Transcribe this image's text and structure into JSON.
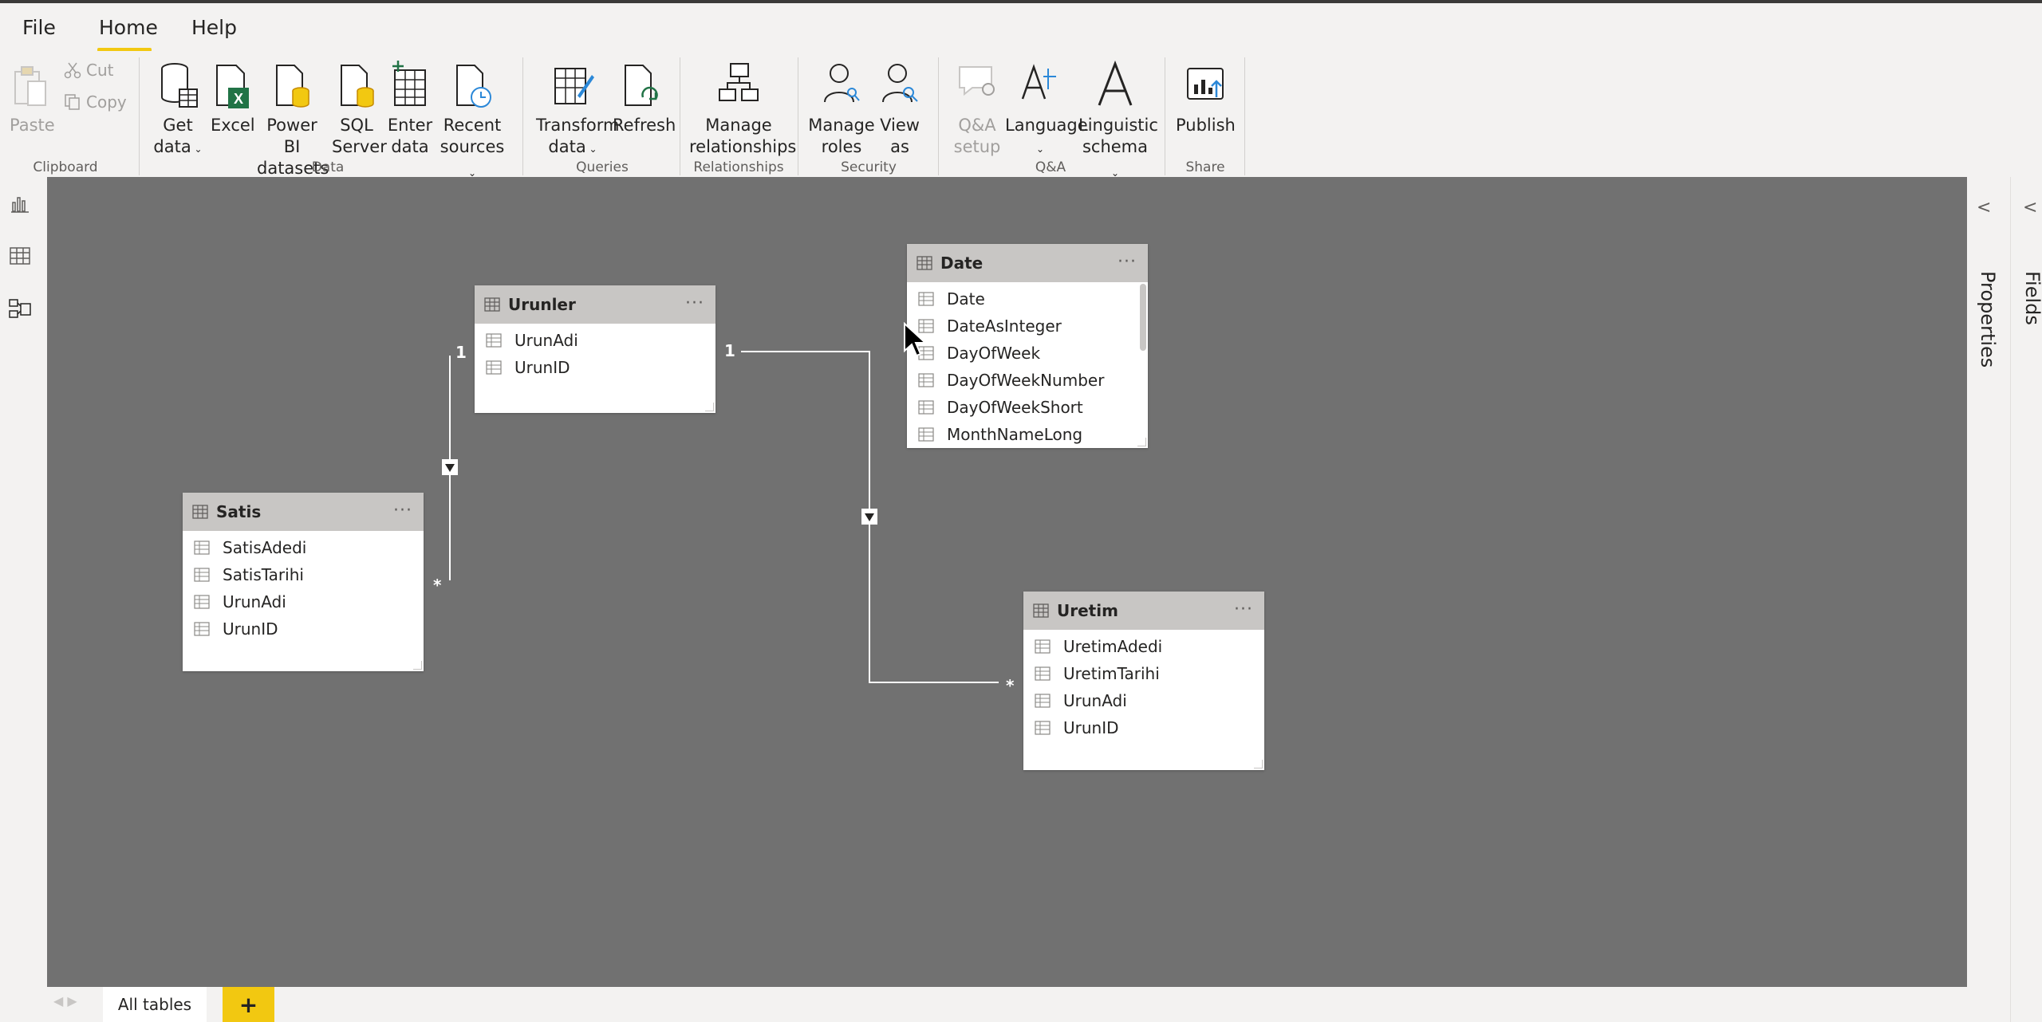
{
  "menu": {
    "file": "File",
    "home": "Home",
    "help": "Help"
  },
  "ribbon": {
    "clipboard": {
      "paste": "Paste",
      "cut": "Cut",
      "copy": "Copy",
      "group": "Clipboard"
    },
    "data": {
      "get_data": [
        "Get",
        "data"
      ],
      "excel": "Excel",
      "powerbi": [
        "Power BI",
        "datasets"
      ],
      "sql": [
        "SQL",
        "Server"
      ],
      "enter": [
        "Enter",
        "data"
      ],
      "recent": [
        "Recent",
        "sources"
      ],
      "group": "Data"
    },
    "queries": {
      "transform": [
        "Transform",
        "data"
      ],
      "refresh": "Refresh",
      "group": "Queries"
    },
    "relationships": {
      "manage": [
        "Manage",
        "relationships"
      ],
      "group": "Relationships"
    },
    "security": {
      "roles": [
        "Manage",
        "roles"
      ],
      "viewas": [
        "View",
        "as"
      ],
      "group": "Security"
    },
    "qa": {
      "setup": [
        "Q&A",
        "setup"
      ],
      "language": "Language",
      "linguistic": [
        "Linguistic",
        "schema"
      ],
      "group": "Q&A"
    },
    "share": {
      "publish": "Publish",
      "group": "Share"
    }
  },
  "tables": {
    "urunler": {
      "title": "Urunler",
      "fields": [
        "UrunAdi",
        "UrunID"
      ]
    },
    "date": {
      "title": "Date",
      "fields": [
        "Date",
        "DateAsInteger",
        "DayOfWeek",
        "DayOfWeekNumber",
        "DayOfWeekShort",
        "MonthNameLong"
      ]
    },
    "satis": {
      "title": "Satis",
      "fields": [
        "SatisAdedi",
        "SatisTarihi",
        "UrunAdi",
        "UrunID"
      ]
    },
    "uretim": {
      "title": "Uretim",
      "fields": [
        "UretimAdedi",
        "UretimTarihi",
        "UrunAdi",
        "UrunID"
      ]
    }
  },
  "relationships": [
    {
      "from": "Urunler",
      "to": "Satis",
      "one": "1",
      "many": "*"
    },
    {
      "from": "Urunler",
      "to": "Uretim",
      "one": "1",
      "many": "*"
    }
  ],
  "more_icon": "···",
  "panes": {
    "properties": "Properties",
    "fields": "Fields",
    "collapse_icon": "<"
  },
  "bottom": {
    "all_tables": "All tables",
    "add": "+"
  },
  "colors": {
    "accent": "#f2c811",
    "canvas": "#717171",
    "header": "#c8c6c4",
    "excel_green": "#217346",
    "blue_icon": "#2b88d8"
  }
}
